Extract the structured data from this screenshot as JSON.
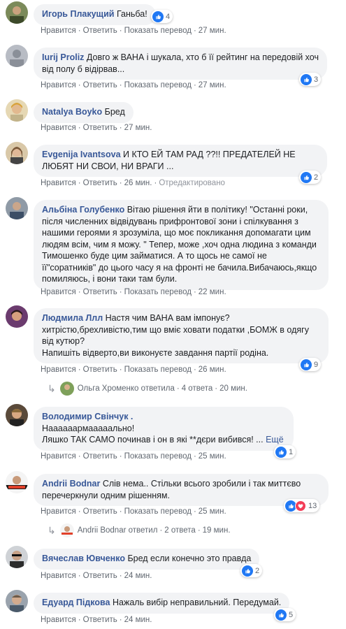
{
  "actions": {
    "like": "Нравится",
    "reply": "Ответить",
    "translate": "Показать перевод",
    "dot": "·",
    "edited": "Отредактировано"
  },
  "comments": [
    {
      "author": "Игорь Плакущий",
      "text": "Ганьба!",
      "time": "27 мин.",
      "reactions": "4"
    },
    {
      "author": "Iurij Proliz",
      "text": "Довго ж ВАНА і шукала, хто б її рейтинг на передовій хоч від полу б відірвав...",
      "time": "27 мин.",
      "reactions": "3"
    },
    {
      "author": "Natalya Boyko",
      "text": "Бред",
      "time": "27 мин."
    },
    {
      "author": "Evgenija Ivantsova",
      "text": "И КТО ЕЙ ТАМ РАД ??!! ПРЕДАТЕЛЕЙ НЕ ЛЮБЯТ НИ СВОИ, НИ ВРАГИ ...",
      "time": "26 мин.",
      "reactions": "2"
    },
    {
      "author": "Альбіна Голубенко",
      "text": "Вітаю рішення йти в політику! \"Останні роки, після численних відвідувань прифронтової зони і спілкування з нашими героями я зрозуміла, що моє покликання допомагати цим людям всім, чим я можу. \" Тепер, може ,хоч одна людина з команди Тимошенко буде цим займатися. А то щось не самої не її\"соратників\" до цього часу я на фронті не бачила.Вибачаюсь,якщо помиляюсь, і вони таки там були.",
      "time": "22 мин."
    },
    {
      "author": "Людмила Ллл",
      "line1": "Настя чим ВАНА вам імпонує?",
      "line2": "хитрістю,брехливістю,тим що вміє ховати податки ,БОМЖ в одягу від кутюр?",
      "line3": "Напишіть відверто,ви виконуєте завдання партії родіна.",
      "time": "26 мин.",
      "reactions": "9",
      "replies": {
        "name": "Ольга Хроменко",
        "verb": "ответила",
        "count": "4 ответа",
        "time": "20 мин."
      }
    },
    {
      "author": "Володимир Свінчук .",
      "line1": "Наааааармааааально!",
      "line2": "Ляшко ТАК САМО починав і он в які **дєри вибився! ...",
      "more": "Ещё",
      "time": "25 мин.",
      "reactions": "1"
    },
    {
      "author": "Andrii Bodnar",
      "text": "Слів нема.. Стільки всього зробили і так миттєво перечеркнули одним рішенням.",
      "time": "25 мин.",
      "reactions": "13",
      "replies": {
        "name": "Andrii Bodnar",
        "verb": "ответил",
        "count": "2 ответа",
        "time": "19 мин."
      }
    },
    {
      "author": "Вячеслав Ювченко",
      "text": "Бред если конечно это правда",
      "time": "24 мин.",
      "reactions": "2"
    },
    {
      "author": "Едуард Підкова",
      "text": "Нажаль вибір неправильний. Передумай.",
      "time": "24 мин.",
      "reactions": "5"
    }
  ],
  "icons": {
    "like": "thumbs-up-icon",
    "love": "heart-icon",
    "reply_arrow": "reply-arrow-icon"
  },
  "colors": {
    "link": "#385898",
    "bubble": "#f2f3f5",
    "like": "#2078f4",
    "love": "#f33e58",
    "muted": "#606770"
  }
}
